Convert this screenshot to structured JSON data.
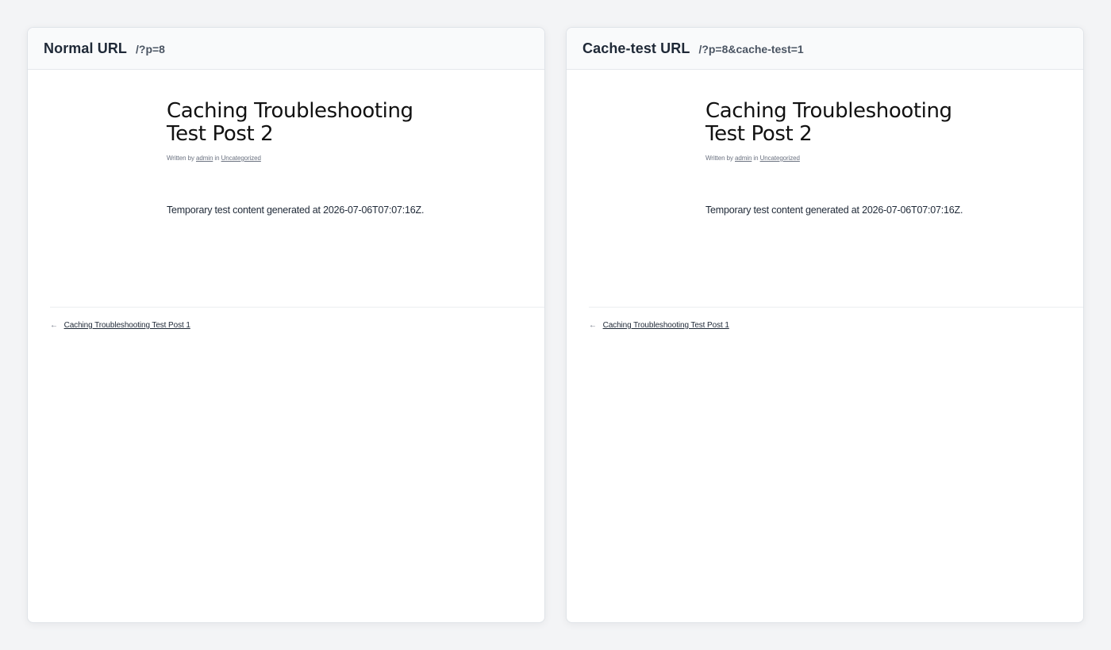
{
  "panels": [
    {
      "title": "Normal URL",
      "url": "/?p=8",
      "post": {
        "title": "Caching Troubleshooting Test Post 2",
        "meta_written_by": "Written by",
        "meta_author": "admin",
        "meta_in": "in",
        "meta_category": "Uncategorized",
        "content": "Temporary test content generated at 2026-07-06T07:07:16Z.",
        "prev_arrow": "←",
        "prev_link": "Caching Troubleshooting Test Post 1"
      }
    },
    {
      "title": "Cache-test URL",
      "url": "/?p=8&cache-test=1",
      "post": {
        "title": "Caching Troubleshooting Test Post 2",
        "meta_written_by": "Written by",
        "meta_author": "admin",
        "meta_in": "in",
        "meta_category": "Uncategorized",
        "content": "Temporary test content generated at 2026-07-06T07:07:16Z.",
        "prev_arrow": "←",
        "prev_link": "Caching Troubleshooting Test Post 1"
      }
    }
  ],
  "colors": {
    "page_background": "#f3f4f6",
    "panel_header": "#f9fafb",
    "title_text": "#1f2937",
    "url_text": "#4b5563"
  }
}
